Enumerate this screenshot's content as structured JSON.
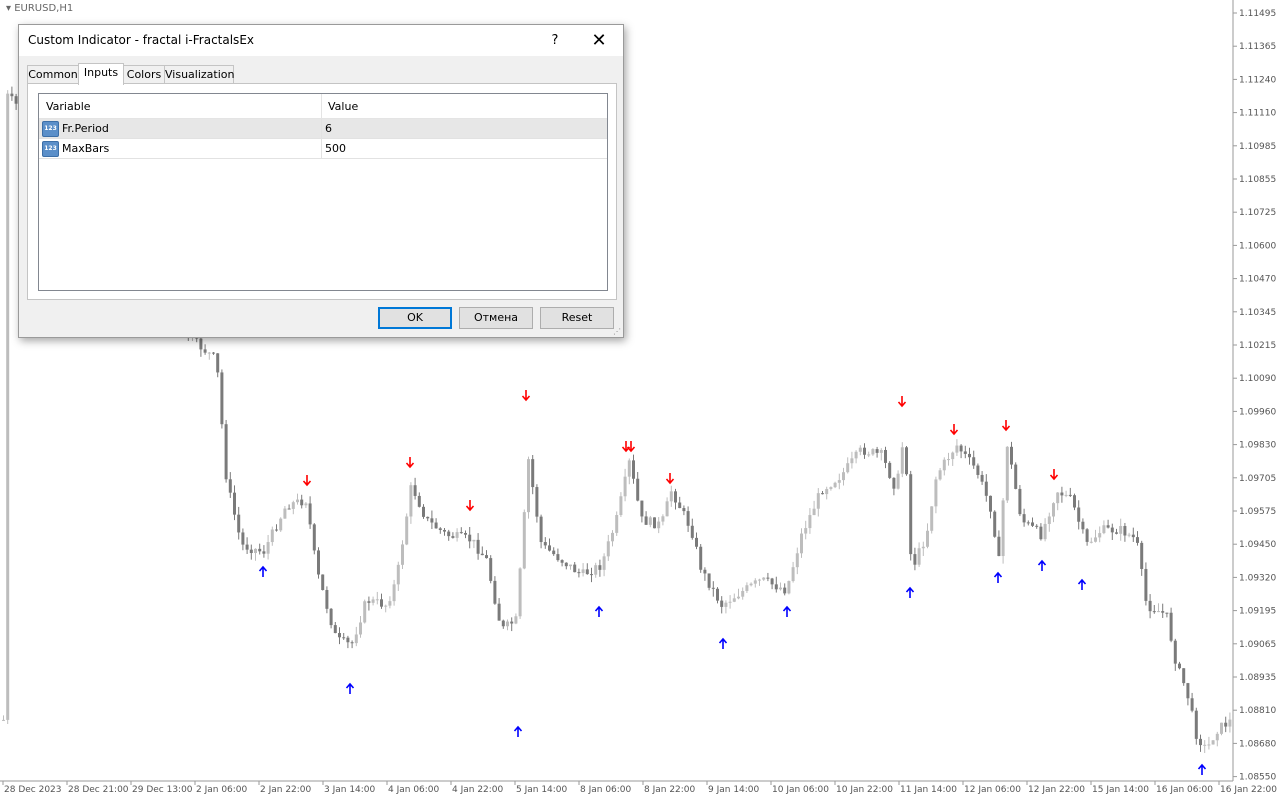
{
  "chart": {
    "symbol": "EURUSD,H1",
    "price_ticks": [
      "1.11495",
      "1.11365",
      "1.11240",
      "1.11110",
      "1.10985",
      "1.10855",
      "1.10725",
      "1.10600",
      "1.10470",
      "1.10345",
      "1.10215",
      "1.10090",
      "1.09960",
      "1.09830",
      "1.09705",
      "1.09575",
      "1.09450",
      "1.09320",
      "1.09195",
      "1.09065",
      "1.08935",
      "1.08810",
      "1.08680",
      "1.08550"
    ],
    "time_ticks": [
      "28 Dec 2023",
      "28 Dec 21:00",
      "29 Dec 13:00",
      "2 Jan 06:00",
      "2 Jan 22:00",
      "3 Jan 14:00",
      "4 Jan 06:00",
      "4 Jan 22:00",
      "5 Jan 14:00",
      "8 Jan 06:00",
      "8 Jan 22:00",
      "9 Jan 14:00",
      "10 Jan 06:00",
      "10 Jan 22:00",
      "11 Jan 14:00",
      "12 Jan 06:00",
      "12 Jan 22:00",
      "15 Jan 14:00",
      "16 Jan 06:00",
      "16 Jan 22:00"
    ],
    "colors": {
      "bull": "#bdbdbd",
      "bear": "#7a7a7a",
      "fractal_up": "#0000ff",
      "fractal_down": "#ff0000",
      "axis": "#9a9a9a"
    }
  },
  "dialog": {
    "title": "Custom Indicator - fractal i-FractalsEx",
    "help_label": "?",
    "close_icon": "close-icon",
    "tabs": [
      "Common",
      "Inputs",
      "Colors",
      "Visualization"
    ],
    "active_tab": "Inputs",
    "columns": {
      "variable": "Variable",
      "value": "Value"
    },
    "rows": [
      {
        "variable": "Fr.Period",
        "value": "6",
        "icon": "123"
      },
      {
        "variable": "MaxBars",
        "value": "500",
        "icon": "123"
      }
    ],
    "buttons": {
      "ok": "OK",
      "cancel": "Отмена",
      "reset": "Reset"
    }
  }
}
